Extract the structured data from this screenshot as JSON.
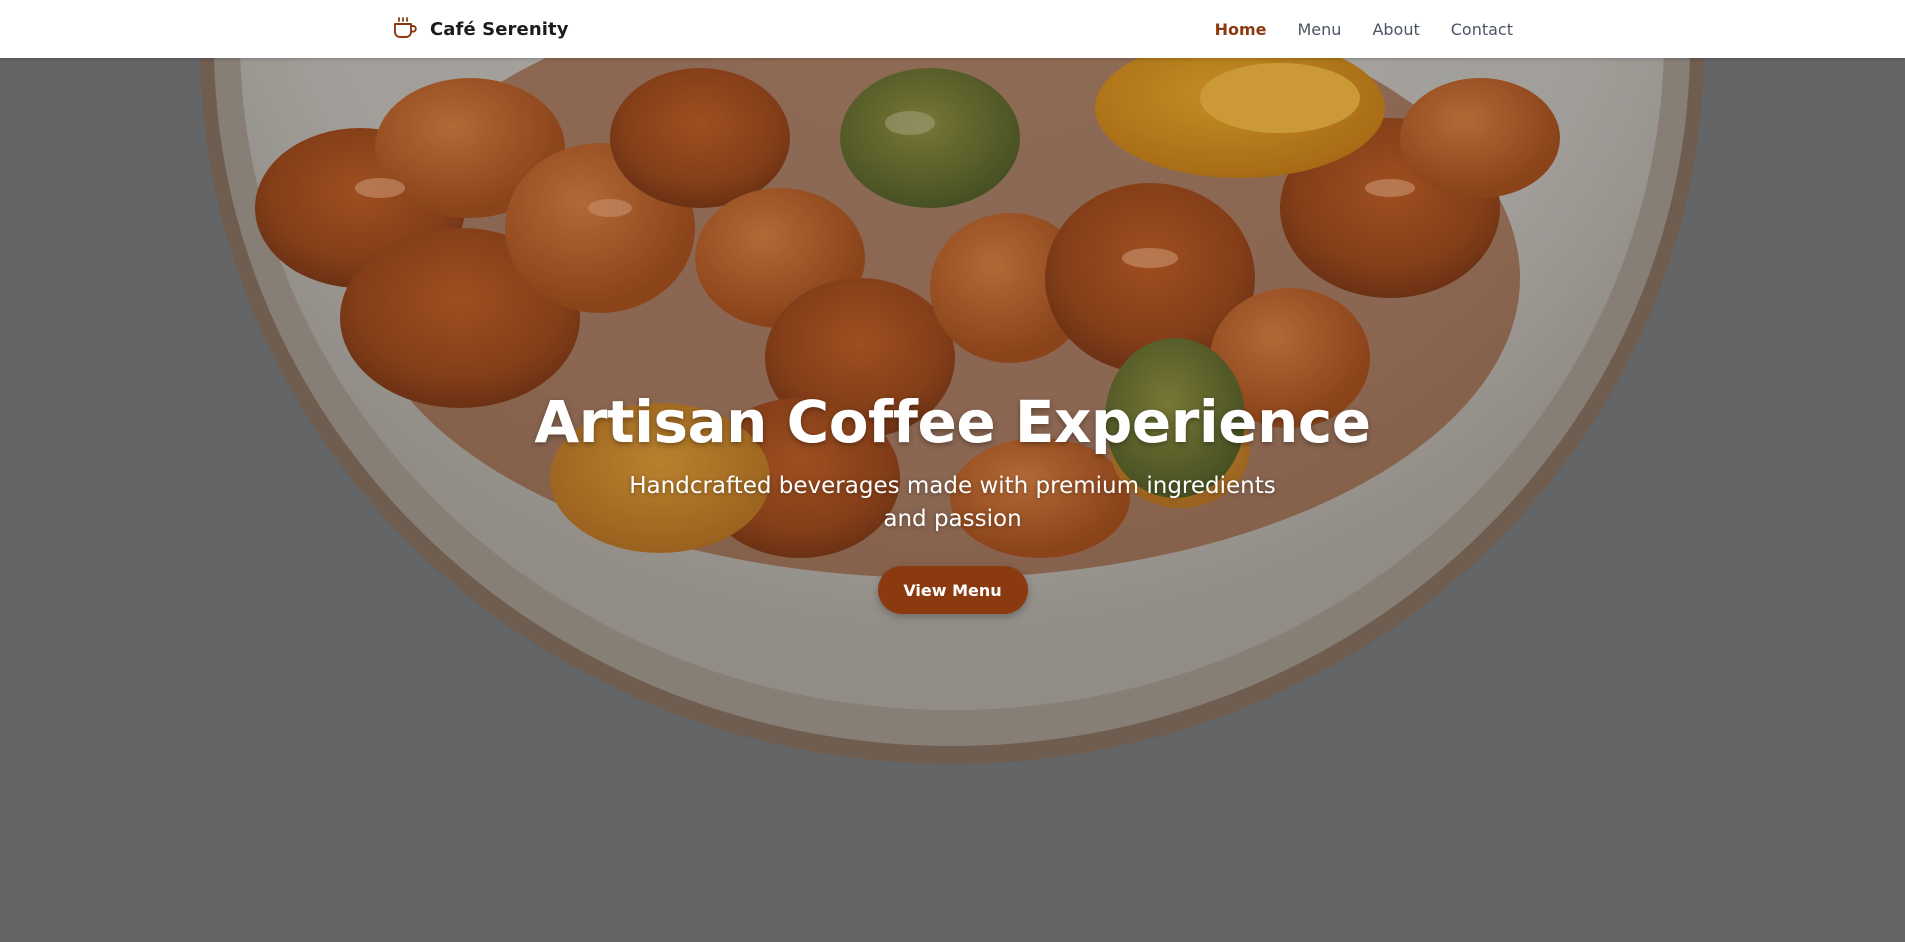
{
  "navbar": {
    "brand_icon": "coffee-cup-icon",
    "brand_name": "Café Serenity",
    "links": [
      {
        "label": "Home",
        "active": true
      },
      {
        "label": "Menu",
        "active": false
      },
      {
        "label": "About",
        "active": false
      },
      {
        "label": "Contact",
        "active": false
      }
    ]
  },
  "hero": {
    "background_image": "plate of glazed sweet and sour chicken with peppers and pineapple",
    "title": "Artisan Coffee Experience",
    "subtitle": "Handcrafted beverages made with premium ingredients and passion",
    "button_label": "View Menu"
  },
  "colors": {
    "accent": "#8b3a0f",
    "nav_text": "#4b5563",
    "navbar_bg": "#ffffff",
    "hero_text": "#ffffff"
  }
}
